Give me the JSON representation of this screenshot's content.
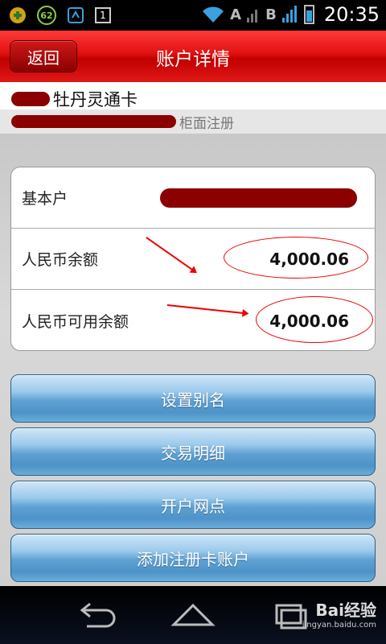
{
  "status_bar": {
    "notif_badge": "62",
    "notif_box": "1",
    "signal_a": "A",
    "signal_b": "B",
    "time": "20:35"
  },
  "header": {
    "back_label": "返回",
    "title": "账户详情"
  },
  "card": {
    "name": "牡丹灵通卡",
    "registration": "柜面注册"
  },
  "account_info": {
    "rows": [
      {
        "label": "基本户",
        "value": ""
      },
      {
        "label": "人民币余额",
        "value": "4,000.06"
      },
      {
        "label": "人民币可用余额",
        "value": "4,000.06"
      }
    ]
  },
  "actions": [
    {
      "label": "设置别名"
    },
    {
      "label": "交易明细"
    },
    {
      "label": "开户网点"
    },
    {
      "label": "添加注册卡账户"
    }
  ],
  "navbar": {
    "icons": [
      "back-icon",
      "home-icon",
      "recent-apps-icon"
    ],
    "watermark": "Bai经验",
    "watermark_sub": "jingyan.baidu.com"
  },
  "colors": {
    "title_red": "#e01010",
    "mask_red": "#8b0000",
    "button_blue": "#5ea0d2",
    "annotation_red": "#ee0000"
  }
}
